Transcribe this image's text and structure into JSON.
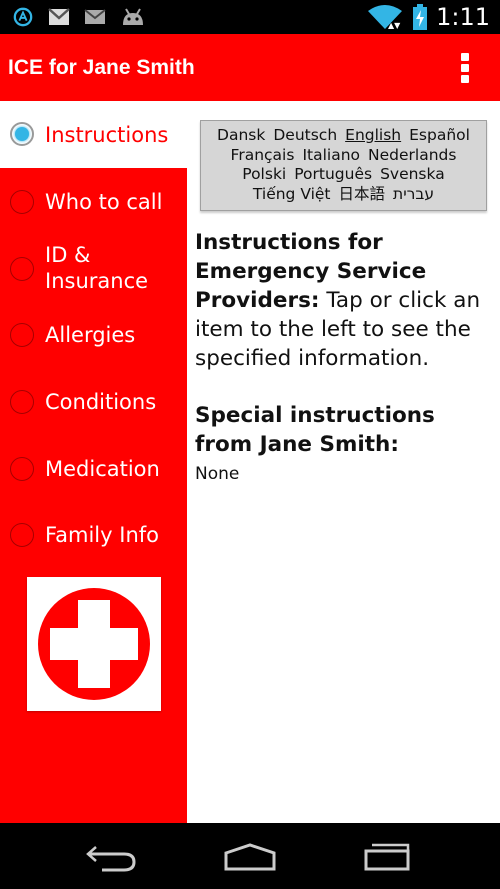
{
  "status_bar": {
    "time": "1:11",
    "icons": [
      "app-notification-icon",
      "gmail-icon",
      "email-icon",
      "android-debug-icon",
      "wifi-icon",
      "battery-charging-icon"
    ]
  },
  "action_bar": {
    "title": "ICE for Jane Smith",
    "overflow_icon": "overflow-menu-icon"
  },
  "sidebar": {
    "items": [
      {
        "label": "Instructions",
        "selected": true
      },
      {
        "label": "Who to call",
        "selected": false
      },
      {
        "label_line1": "ID &",
        "label_line2": "Insurance",
        "selected": false
      },
      {
        "label": "Allergies",
        "selected": false
      },
      {
        "label": "Conditions",
        "selected": false
      },
      {
        "label": "Medication",
        "selected": false
      },
      {
        "label": "Family Info",
        "selected": false
      }
    ],
    "logo_icon": "red-cross-icon"
  },
  "languages": {
    "row1": [
      "Dansk",
      "Deutsch",
      "English",
      "Español"
    ],
    "row2": [
      "Français",
      "Italiano",
      "Nederlands"
    ],
    "row3": [
      "Polski",
      "Português",
      "Svenska"
    ],
    "row4": [
      "Tiếng Việt",
      "日本語",
      "עברית"
    ],
    "active": "English"
  },
  "main": {
    "instructions_bold": "Instructions for Emergency Service Providers:",
    "instructions_text": " Tap or click an item to the left to see the specified information.",
    "special_heading": "Special instructions from Jane Smith:",
    "special_value": "None"
  },
  "nav_bar": {
    "icons": [
      "back-icon",
      "home-icon",
      "recent-apps-icon"
    ]
  },
  "colors": {
    "accent_red": "#ff0000",
    "radio_blue": "#33b5e5",
    "language_box": "#d6d6d6"
  }
}
